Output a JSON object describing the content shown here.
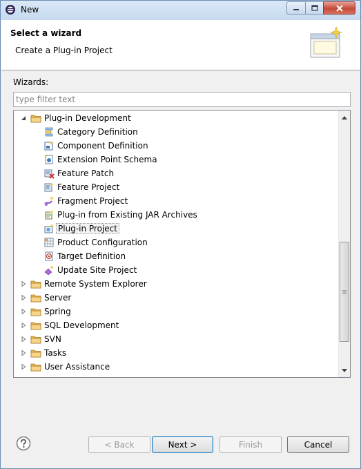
{
  "window": {
    "title": "New"
  },
  "header": {
    "title": "Select a wizard",
    "description": "Create a Plug-in Project"
  },
  "wizards_label": "Wizards:",
  "filter": {
    "placeholder": "type filter text",
    "value": ""
  },
  "tree": {
    "items": [
      {
        "label": "Plug-in Development",
        "type": "folder",
        "level": 0,
        "expanded": true
      },
      {
        "label": "Category Definition",
        "type": "category-icon",
        "level": 1
      },
      {
        "label": "Component Definition",
        "type": "component-icon",
        "level": 1
      },
      {
        "label": "Extension Point Schema",
        "type": "schema-icon",
        "level": 1
      },
      {
        "label": "Feature Patch",
        "type": "feature-patch-icon",
        "level": 1
      },
      {
        "label": "Feature Project",
        "type": "feature-project-icon",
        "level": 1
      },
      {
        "label": "Fragment Project",
        "type": "fragment-icon",
        "level": 1
      },
      {
        "label": "Plug-in from Existing JAR Archives",
        "type": "jar-plugin-icon",
        "level": 1
      },
      {
        "label": "Plug-in Project",
        "type": "plugin-project-icon",
        "level": 1,
        "selected": true
      },
      {
        "label": "Product Configuration",
        "type": "product-icon",
        "level": 1
      },
      {
        "label": "Target Definition",
        "type": "target-icon",
        "level": 1
      },
      {
        "label": "Update Site Project",
        "type": "update-site-icon",
        "level": 1
      },
      {
        "label": "Remote System Explorer",
        "type": "folder",
        "level": 0,
        "expanded": false
      },
      {
        "label": "Server",
        "type": "folder",
        "level": 0,
        "expanded": false
      },
      {
        "label": "Spring",
        "type": "folder",
        "level": 0,
        "expanded": false
      },
      {
        "label": "SQL Development",
        "type": "folder",
        "level": 0,
        "expanded": false
      },
      {
        "label": "SVN",
        "type": "folder",
        "level": 0,
        "expanded": false
      },
      {
        "label": "Tasks",
        "type": "folder",
        "level": 0,
        "expanded": false
      },
      {
        "label": "User Assistance",
        "type": "folder",
        "level": 0,
        "expanded": false
      }
    ]
  },
  "buttons": {
    "back": "< Back",
    "next": "Next >",
    "finish": "Finish",
    "cancel": "Cancel"
  },
  "colors": {
    "folder": "#e8b85a",
    "selection_bg": "#f2f2f2",
    "close_red": "#c44b39"
  }
}
